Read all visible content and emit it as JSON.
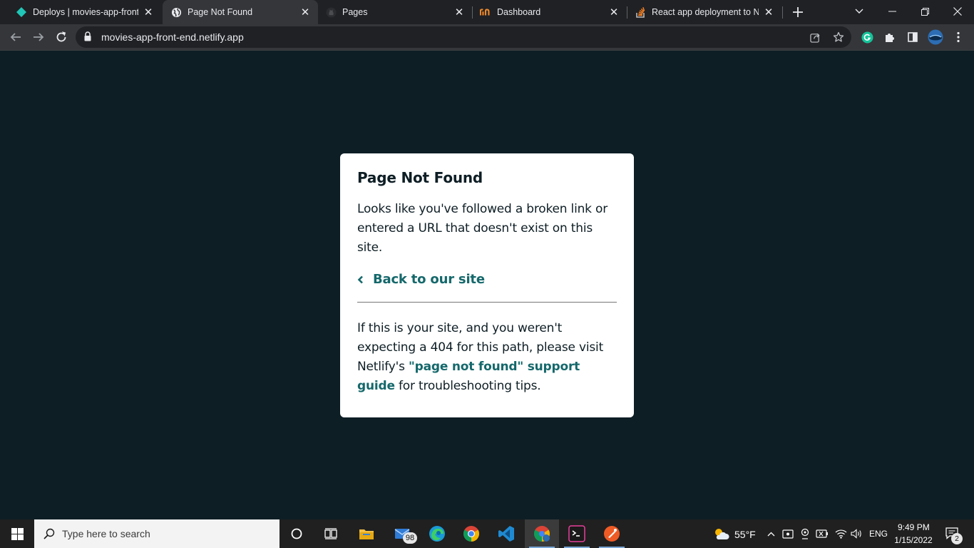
{
  "browser": {
    "tabs": [
      {
        "title": "Deploys | movies-app-front-e",
        "icon": "netlify-diamond-icon"
      },
      {
        "title": "Page Not Found",
        "icon": "globe-icon"
      },
      {
        "title": "Pages",
        "icon": "github-icon"
      },
      {
        "title": "Dashboard",
        "icon": "dev-logo-icon"
      },
      {
        "title": "React app deployment to Ne",
        "icon": "stackoverflow-icon"
      }
    ],
    "active_tab": 1,
    "url": "movies-app-front-end.netlify.app"
  },
  "page": {
    "title": "Page Not Found",
    "message": "Looks like you've followed a broken link or entered a URL that doesn't exist on this site.",
    "back_link": "Back to our site",
    "footer_before": "If this is your site, and you weren't expecting a 404 for this path, please visit Netlify's ",
    "footer_link": "\"page not found\" support guide",
    "footer_after": " for troubleshooting tips.",
    "accent_color": "#15686b",
    "background_color": "#0e1e25"
  },
  "taskbar": {
    "search_placeholder": "Type here to search",
    "mail_badge": "98",
    "weather": "55°F",
    "language": "ENG",
    "time": "9:49 PM",
    "date": "1/15/2022",
    "notification_count": "2"
  }
}
